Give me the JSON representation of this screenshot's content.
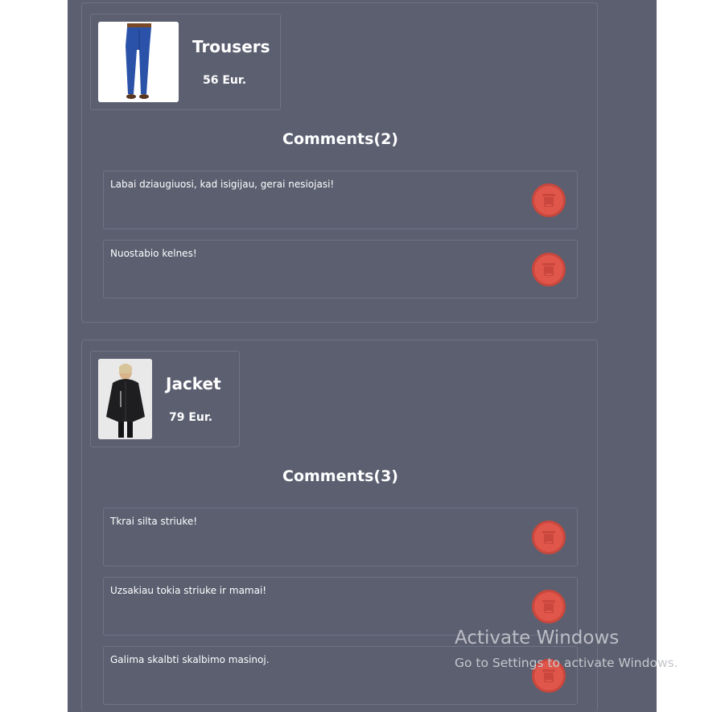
{
  "products": [
    {
      "name": "Trousers",
      "price": "56 Eur.",
      "comments_title": "Comments(2)",
      "comments": [
        "Labai dziaugiuosi, kad isigijau, gerai nesiojasi!",
        "Nuostabio kelnes!"
      ]
    },
    {
      "name": "Jacket",
      "price": "79 Eur.",
      "comments_title": "Comments(3)",
      "comments": [
        "Tkrai silta striuke!",
        "Uzsakiau tokia striuke ir mamai!",
        "Galima skalbti skalbimo masinoj."
      ]
    }
  ],
  "watermark": {
    "title": "Activate Windows",
    "subtitle": "Go to Settings to activate Windows."
  },
  "colors": {
    "panel": "#5b5f70",
    "delete_button": "#e0564b"
  },
  "icons": {
    "delete": "trash-icon"
  }
}
